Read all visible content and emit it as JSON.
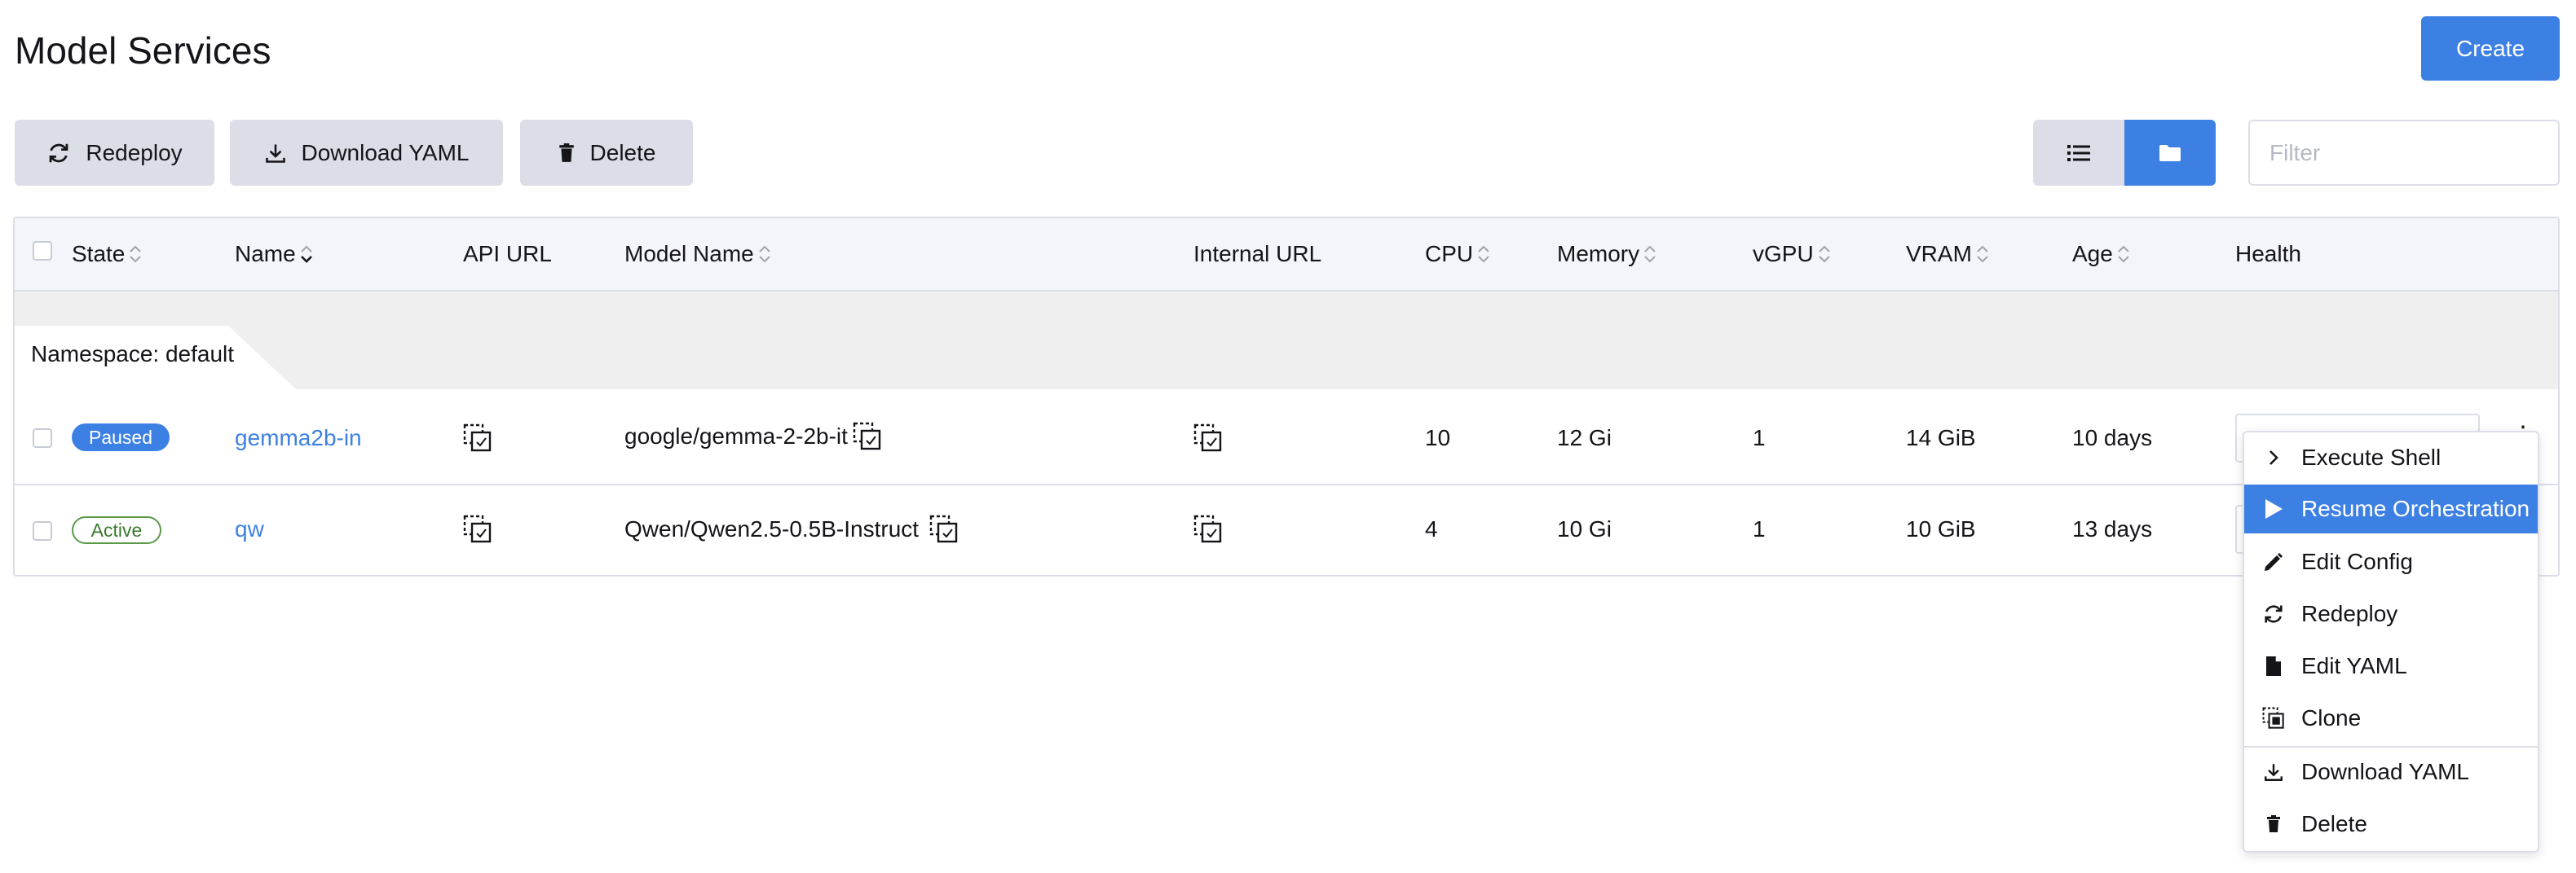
{
  "page": {
    "title": "Model Services"
  },
  "toolbar": {
    "redeploy": "Redeploy",
    "download_yaml": "Download YAML",
    "delete": "Delete",
    "create": "Create",
    "filter_placeholder": "Filter"
  },
  "view_toggle": {
    "list_icon": "list-icon",
    "folder_icon": "folder-icon",
    "selected": "folder"
  },
  "table": {
    "columns": [
      "State",
      "Name",
      "API URL",
      "Model Name",
      "Internal URL",
      "CPU",
      "Memory",
      "vGPU",
      "VRAM",
      "Age",
      "Health"
    ],
    "namespace_label": "Namespace:",
    "namespace_value": "default",
    "rows": [
      {
        "state": "Paused",
        "name": "gemma2b-in",
        "model_name": "google/gemma-2-2b-it",
        "cpu": "10",
        "memory": "12 Gi",
        "vgpu": "1",
        "vram": "14 GiB",
        "age": "10 days"
      },
      {
        "state": "Active",
        "name": "qw",
        "model_name": "Qwen/Qwen2.5-0.5B-Instruct",
        "cpu": "4",
        "memory": "10 Gi",
        "vgpu": "1",
        "vram": "10 GiB",
        "age": "13 days"
      }
    ]
  },
  "context_menu": {
    "items": [
      {
        "label": "Execute Shell",
        "icon": "chevron-right-icon"
      },
      {
        "label": "Resume Orchestration",
        "icon": "play-icon",
        "highlighted": true
      },
      {
        "label": "Edit Config",
        "icon": "pencil-icon"
      },
      {
        "label": "Redeploy",
        "icon": "refresh-icon"
      },
      {
        "label": "Edit YAML",
        "icon": "file-icon"
      },
      {
        "label": "Clone",
        "icon": "clone-icon"
      },
      {
        "label": "Download YAML",
        "icon": "download-icon"
      },
      {
        "label": "Delete",
        "icon": "trash-icon"
      }
    ]
  },
  "colors": {
    "primary": "#3d80e4",
    "button_grey": "#dcdee7",
    "active_green": "#3b7a2c"
  }
}
